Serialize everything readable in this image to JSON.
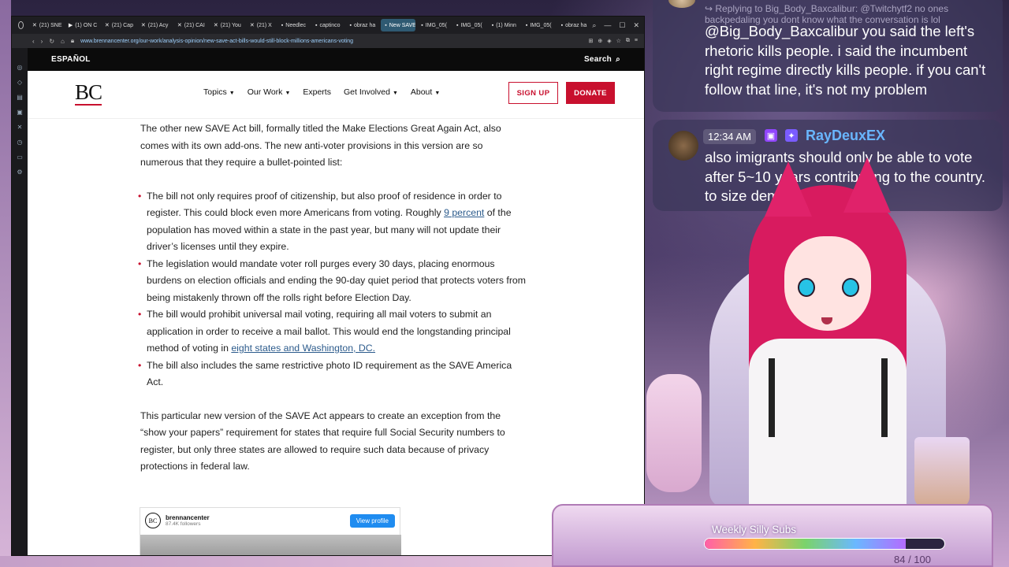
{
  "browser": {
    "tabs": [
      {
        "label": "(21) SNE",
        "icon": "x-icon"
      },
      {
        "label": "(1) ON C",
        "icon": "youtube-icon"
      },
      {
        "label": "(21) Cap",
        "icon": "x-icon"
      },
      {
        "label": "(21) Acy",
        "icon": "x-icon"
      },
      {
        "label": "(21) CAI",
        "icon": "x-icon"
      },
      {
        "label": "(21) You",
        "icon": "x-icon"
      },
      {
        "label": "(21) X",
        "icon": "x-icon"
      },
      {
        "label": "Needlec",
        "icon": "page-icon"
      },
      {
        "label": "captinco",
        "icon": "page-icon"
      },
      {
        "label": "obraz ha",
        "icon": "page-icon"
      },
      {
        "label": "New SAVE Act I",
        "icon": "page-icon",
        "active": true
      },
      {
        "label": "IMG_05(",
        "icon": "page-icon"
      },
      {
        "label": "IMG_05(",
        "icon": "page-icon"
      },
      {
        "label": "(1) Minn",
        "icon": "page-icon"
      },
      {
        "label": "IMG_05(",
        "icon": "page-icon"
      },
      {
        "label": "obraz ha",
        "icon": "page-icon"
      }
    ],
    "url": "www.brennancenter.org/our-work/analysis-opinion/new-save-act-bills-would-still-block-millions-americans-voting"
  },
  "site": {
    "topbar": {
      "espanol": "ESPAÑOL",
      "search": "Search"
    },
    "logo": "BC",
    "menu": [
      "Topics",
      "Our Work",
      "Experts",
      "Get Involved",
      "About"
    ],
    "signup": "SIGN UP",
    "donate": "DONATE"
  },
  "article": {
    "intro": "The other new SAVE Act bill, formally titled the Make Elections Great Again Act, also comes with its own add-ons. The new anti-voter provisions in this version are so numerous that they require a bullet-pointed list:",
    "b1_pre": "The bill not only requires proof of citizenship, but also proof of residence in order to register. This could block even more Americans from voting. Roughly ",
    "b1_link": "9 percent",
    "b1_post": " of the population has moved within a state in the past year, but many will not update their driver’s licenses until they expire.",
    "b2": "The legislation would mandate voter roll purges every 30 days, placing enormous burdens on election officials and ending the 90-day quiet period that protects voters from being mistakenly thrown off the rolls right before Election Day.",
    "b3_pre": "The bill would prohibit universal mail voting, requiring all mail voters to submit an application in order to receive a mail ballot. This would end the longstanding principal method of voting in ",
    "b3_link": "eight states and Washington, DC.",
    "b4": "The bill also includes the same restrictive photo ID requirement as the SAVE America Act.",
    "closing": "This particular new version of the SAVE Act appears to create an exception from the “show your papers” requirement for states that require full Social Security numbers to register, but only three states are allowed to require such data because of privacy protections in federal law."
  },
  "instagram": {
    "avatar": "BC",
    "name": "brennancenter",
    "followers": "87.4K followers",
    "button": "View profile"
  },
  "chat": {
    "m1": {
      "reply": "↪ Replying to Big_Body_Baxcalibur: @Twitchytf2 no ones backpedaling you dont know what the conversation is lol",
      "body": "@Big_Body_Baxcalibur you said the left's rhetoric kills people. i said the incumbent right regime directly kills people. if you can't follow that line, it's not my problem"
    },
    "m2": {
      "time": "12:34 AM",
      "user": "RayDeuxEX",
      "body": "also imigrants should only be able to vote after 5~10 years contributing to the country. to size democracy"
    }
  },
  "goal": {
    "title": "Weekly Silly Subs",
    "current": 84,
    "target": 100,
    "count_text": "84 / 100",
    "progress_fraction": 0.84
  }
}
